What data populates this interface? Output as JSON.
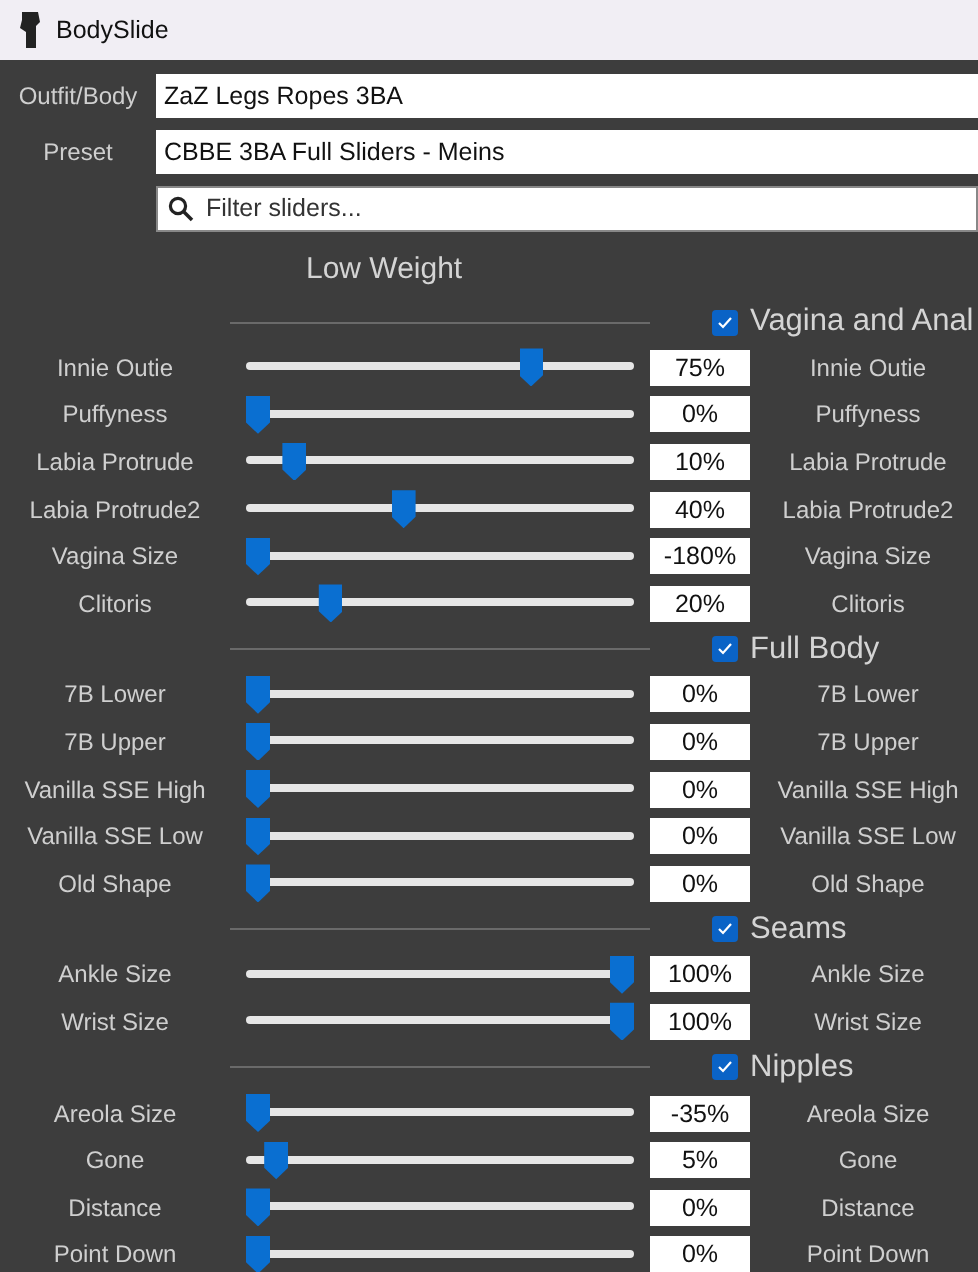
{
  "window": {
    "title": "BodySlide"
  },
  "outfit_body": {
    "label": "Outfit/Body",
    "value": "ZaZ Legs Ropes 3BA"
  },
  "preset": {
    "label": "Preset",
    "value": "CBBE 3BA Full Sliders - Meins"
  },
  "filter": {
    "placeholder": "Filter sliders..."
  },
  "column_heading": "Low Weight",
  "groups": [
    {
      "title": "Vagina and Anal",
      "checked": true,
      "sliders": [
        {
          "name": "Innie Outie",
          "level": 0.75,
          "reading": "75%",
          "right_label": "Innie Outie"
        },
        {
          "name": "Puffyness",
          "level": 0,
          "reading": "0%",
          "right_label": "Puffyness"
        },
        {
          "name": "Labia Protrude",
          "level": 0.1,
          "reading": "10%",
          "right_label": "Labia Protrude"
        },
        {
          "name": "Labia Protrude2",
          "level": 0.4,
          "reading": "40%",
          "right_label": "Labia Protrude2"
        },
        {
          "name": "Vagina Size",
          "level": 0,
          "reading": "-180%",
          "right_label": "Vagina Size"
        },
        {
          "name": "Clitoris",
          "level": 0.2,
          "reading": "20%",
          "right_label": "Clitoris"
        }
      ]
    },
    {
      "title": "Full Body",
      "checked": true,
      "sliders": [
        {
          "name": "7B Lower",
          "level": 0,
          "reading": "0%",
          "right_label": "7B Lower"
        },
        {
          "name": "7B Upper",
          "level": 0,
          "reading": "0%",
          "right_label": "7B Upper"
        },
        {
          "name": "Vanilla SSE High",
          "level": 0,
          "reading": "0%",
          "right_label": "Vanilla SSE High"
        },
        {
          "name": "Vanilla SSE Low",
          "level": 0,
          "reading": "0%",
          "right_label": "Vanilla SSE Low"
        },
        {
          "name": "Old Shape",
          "level": 0,
          "reading": "0%",
          "right_label": "Old Shape"
        }
      ]
    },
    {
      "title": "Seams",
      "checked": true,
      "sliders": [
        {
          "name": "Ankle Size",
          "level": 1,
          "reading": "100%",
          "right_label": "Ankle Size"
        },
        {
          "name": "Wrist Size",
          "level": 1,
          "reading": "100%",
          "right_label": "Wrist Size"
        }
      ]
    },
    {
      "title": "Nipples",
      "checked": true,
      "sliders": [
        {
          "name": "Areola Size",
          "level": 0,
          "reading": "-35%",
          "right_label": "Areola Size"
        },
        {
          "name": "Gone",
          "level": 0.05,
          "reading": "5%",
          "right_label": "Gone"
        },
        {
          "name": "Distance",
          "level": 0,
          "reading": "0%",
          "right_label": "Distance"
        },
        {
          "name": "Point Down",
          "level": 0,
          "reading": "0%",
          "right_label": "Point Down"
        }
      ]
    }
  ]
}
